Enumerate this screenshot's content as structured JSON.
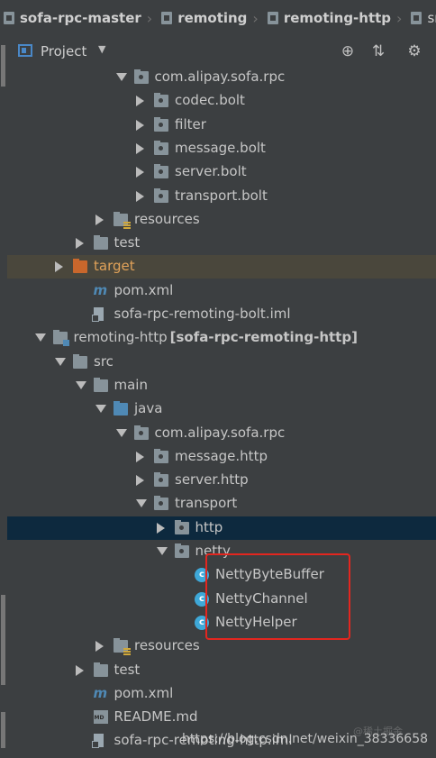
{
  "breadcrumb": [
    {
      "label": "sofa-rpc-master",
      "bold": true
    },
    {
      "label": "remoting",
      "bold": true
    },
    {
      "label": "remoting-http",
      "bold": true
    },
    {
      "label": "src",
      "bold": false
    }
  ],
  "toolbar": {
    "title": "Project",
    "dropdown_icon": "caret-down-icon",
    "buttons": [
      "locate-icon",
      "collapse-all-icon",
      "settings-gear-icon"
    ]
  },
  "tree": [
    {
      "label": "com.alipay.sofa.rpc",
      "depth": 6,
      "expanded": true,
      "icon": "package-folder-icon"
    },
    {
      "label": "codec.bolt",
      "depth": 7,
      "expanded": false,
      "icon": "package-folder-icon"
    },
    {
      "label": "filter",
      "depth": 7,
      "expanded": false,
      "icon": "package-folder-icon"
    },
    {
      "label": "message.bolt",
      "depth": 7,
      "expanded": false,
      "icon": "package-folder-icon"
    },
    {
      "label": "server.bolt",
      "depth": 7,
      "expanded": false,
      "icon": "package-folder-icon"
    },
    {
      "label": "transport.bolt",
      "depth": 7,
      "expanded": false,
      "icon": "package-folder-icon"
    },
    {
      "label": "resources",
      "depth": 5,
      "expanded": false,
      "icon": "resources-folder-icon"
    },
    {
      "label": "test",
      "depth": 4,
      "expanded": false,
      "icon": "folder-icon"
    },
    {
      "label": "target",
      "depth": 3,
      "expanded": false,
      "icon": "excluded-folder-icon",
      "highlight": "target"
    },
    {
      "label": "pom.xml",
      "depth": 4,
      "icon": "maven-file-icon"
    },
    {
      "label": "sofa-rpc-remoting-bolt.iml",
      "depth": 4,
      "icon": "iml-file-icon"
    },
    {
      "label": "remoting-http",
      "suffix": "[sofa-rpc-remoting-http]",
      "depth": 2,
      "expanded": true,
      "icon": "module-folder-icon"
    },
    {
      "label": "src",
      "depth": 3,
      "expanded": true,
      "icon": "folder-icon"
    },
    {
      "label": "main",
      "depth": 4,
      "expanded": true,
      "icon": "folder-icon"
    },
    {
      "label": "java",
      "depth": 5,
      "expanded": true,
      "icon": "source-folder-icon"
    },
    {
      "label": "com.alipay.sofa.rpc",
      "depth": 6,
      "expanded": true,
      "icon": "package-folder-icon"
    },
    {
      "label": "message.http",
      "depth": 7,
      "expanded": false,
      "icon": "package-folder-icon"
    },
    {
      "label": "server.http",
      "depth": 7,
      "expanded": false,
      "icon": "package-folder-icon"
    },
    {
      "label": "transport",
      "depth": 7,
      "expanded": true,
      "icon": "package-folder-icon"
    },
    {
      "label": "http",
      "depth": 8,
      "expanded": false,
      "icon": "package-folder-icon",
      "highlight": "selected"
    },
    {
      "label": "netty",
      "depth": 8,
      "expanded": true,
      "icon": "package-folder-icon"
    },
    {
      "label": "NettyByteBuffer",
      "depth": 9,
      "icon": "class-icon"
    },
    {
      "label": "NettyChannel",
      "depth": 9,
      "icon": "class-icon"
    },
    {
      "label": "NettyHelper",
      "depth": 9,
      "icon": "class-icon"
    },
    {
      "label": "resources",
      "depth": 5,
      "expanded": false,
      "icon": "resources-folder-icon"
    },
    {
      "label": "test",
      "depth": 4,
      "expanded": false,
      "icon": "folder-icon"
    },
    {
      "label": "pom.xml",
      "depth": 4,
      "icon": "maven-file-icon"
    },
    {
      "label": "README.md",
      "depth": 4,
      "icon": "markdown-file-icon"
    },
    {
      "label": "sofa-rpc-remoting-http.iml",
      "depth": 4,
      "icon": "iml-file-icon"
    }
  ],
  "annotation": {
    "color": "#e3261f"
  },
  "watermark": {
    "text": "https://blog.csdn.net/weixin_38336658",
    "faint": "@稀土掘金"
  },
  "colors": {
    "background": "#3c3f41",
    "selected": "#0d293e",
    "target_row": "#4a473c",
    "class_icon": "#3ea8d8"
  }
}
